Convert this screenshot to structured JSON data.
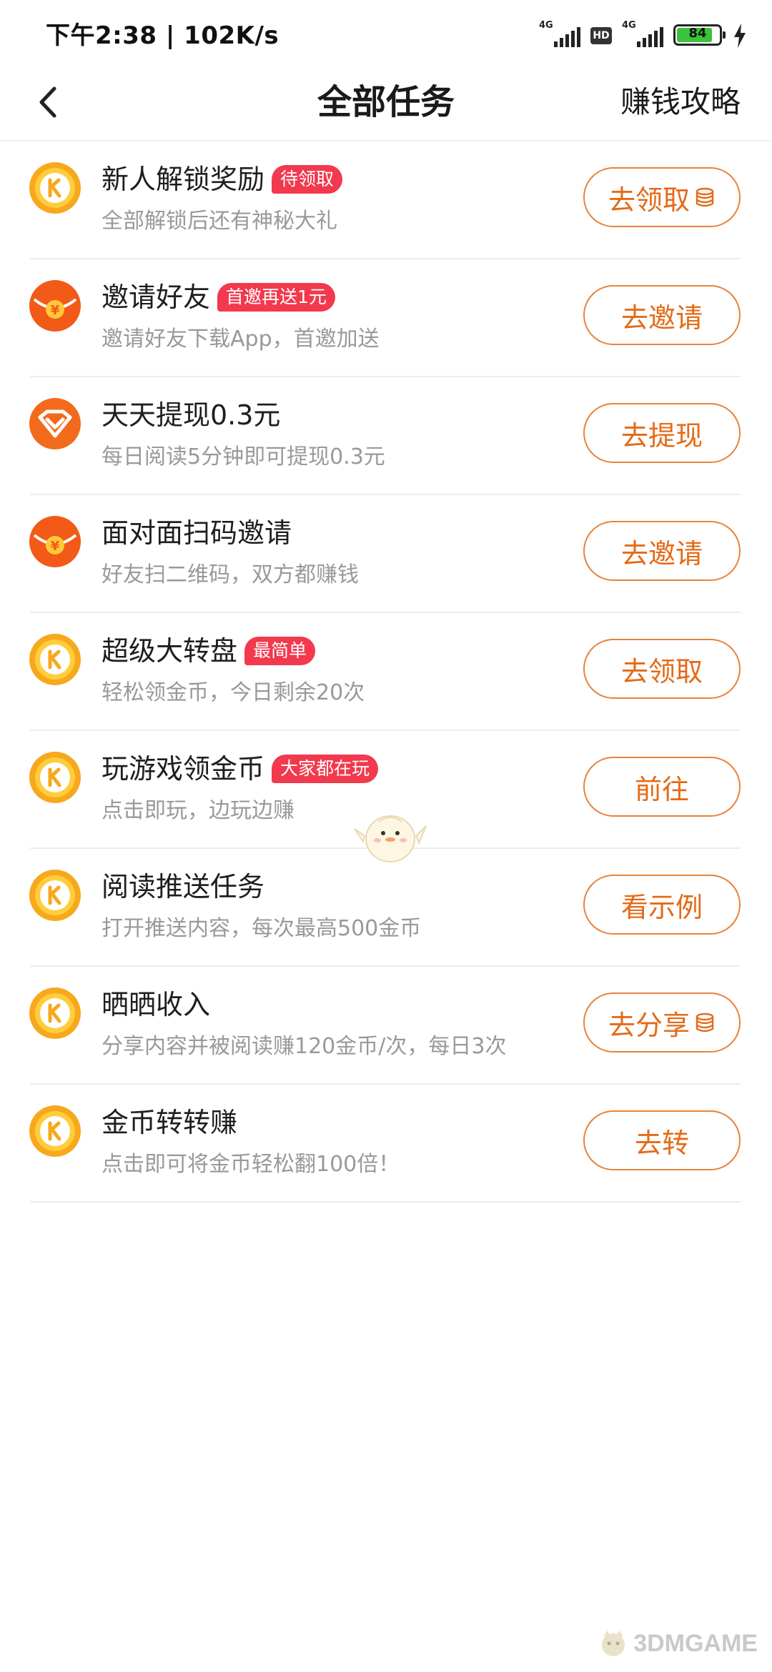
{
  "status_bar": {
    "time": "下午2:38 | 102K/s",
    "signal1_label": "4G",
    "hd_label": "HD",
    "signal2_label": "4G",
    "battery_level": "84"
  },
  "header": {
    "title": "全部任务",
    "guide_link": "赚钱攻略"
  },
  "colors": {
    "accent": "#e46a17",
    "tag": "#f2394d",
    "coin": "#f8a51a",
    "red_icon": "#f25a18"
  },
  "tasks": [
    {
      "icon": "coin-k-icon",
      "name": "新人解锁奖励",
      "tag": "待领取",
      "desc": "全部解锁后还有神秘大礼",
      "button": "去领取",
      "button_has_coins": true
    },
    {
      "icon": "red-envelope-icon",
      "name": "邀请好友",
      "tag": "首邀再送1元",
      "desc": "邀请好友下载App，首邀加送",
      "button": "去邀请",
      "button_has_coins": false
    },
    {
      "icon": "withdraw-icon",
      "name": "天天提现0.3元",
      "tag": "",
      "desc": "每日阅读5分钟即可提现0.3元",
      "button": "去提现",
      "button_has_coins": false
    },
    {
      "icon": "red-envelope-icon",
      "name": "面对面扫码邀请",
      "tag": "",
      "desc": "好友扫二维码，双方都赚钱",
      "button": "去邀请",
      "button_has_coins": false
    },
    {
      "icon": "coin-k-icon",
      "name": "超级大转盘",
      "tag": "最简单",
      "desc": "轻松领金币，今日剩余20次",
      "button": "去领取",
      "button_has_coins": false
    },
    {
      "icon": "coin-k-icon",
      "name": "玩游戏领金币",
      "tag": "大家都在玩",
      "desc": "点击即玩，边玩边赚",
      "button": "前往",
      "button_has_coins": false
    },
    {
      "icon": "coin-k-icon",
      "name": "阅读推送任务",
      "tag": "",
      "desc": "打开推送内容，每次最高500金币",
      "button": "看示例",
      "button_has_coins": false
    },
    {
      "icon": "coin-k-icon",
      "name": "晒晒收入",
      "tag": "",
      "desc": "分享内容并被阅读赚120金币/次，每日3次",
      "button": "去分享",
      "button_has_coins": true
    },
    {
      "icon": "coin-k-icon",
      "name": "金币转转赚",
      "tag": "",
      "desc": "点击即可将金币轻松翻100倍！",
      "button": "去转",
      "button_has_coins": false
    }
  ],
  "watermark": {
    "text": "3DMGAME"
  }
}
